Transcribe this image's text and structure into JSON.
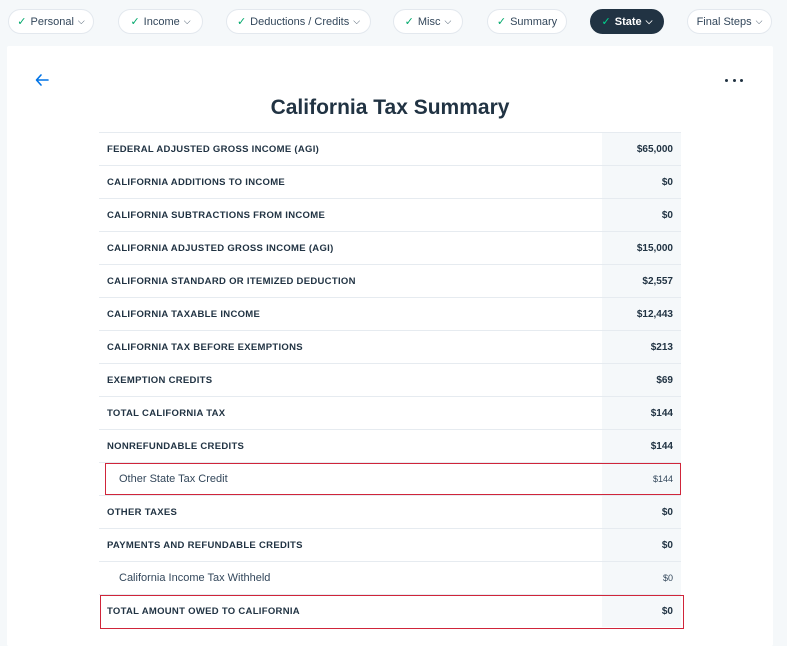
{
  "nav": {
    "tabs": [
      {
        "label": "Personal",
        "checked": true,
        "dropdown": true,
        "active": false
      },
      {
        "label": "Income",
        "checked": true,
        "dropdown": true,
        "active": false
      },
      {
        "label": "Deductions / Credits",
        "checked": true,
        "dropdown": true,
        "active": false
      },
      {
        "label": "Misc",
        "checked": true,
        "dropdown": true,
        "active": false
      },
      {
        "label": "Summary",
        "checked": true,
        "dropdown": false,
        "active": false
      },
      {
        "label": "State",
        "checked": true,
        "dropdown": true,
        "active": true
      },
      {
        "label": "Final Steps",
        "checked": false,
        "dropdown": true,
        "active": false
      }
    ]
  },
  "page": {
    "title": "California Tax Summary",
    "back_icon": "arrow-left-icon",
    "menu_icon": "more-horizontal-icon"
  },
  "summary": {
    "rows": [
      {
        "label": "FEDERAL ADJUSTED GROSS INCOME (AGI)",
        "value": "$65,000"
      },
      {
        "label": "CALIFORNIA ADDITIONS TO INCOME",
        "value": "$0"
      },
      {
        "label": "CALIFORNIA SUBTRACTIONS FROM INCOME",
        "value": "$0"
      },
      {
        "label": "CALIFORNIA ADJUSTED GROSS INCOME (AGI)",
        "value": "$15,000"
      },
      {
        "label": "CALIFORNIA STANDARD OR ITEMIZED DEDUCTION",
        "value": "$2,557"
      },
      {
        "label": "CALIFORNIA TAXABLE INCOME",
        "value": "$12,443"
      },
      {
        "label": "CALIFORNIA TAX BEFORE EXEMPTIONS",
        "value": "$213"
      },
      {
        "label": "EXEMPTION CREDITS",
        "value": "$69"
      },
      {
        "label": "TOTAL CALIFORNIA TAX",
        "value": "$144"
      },
      {
        "label": "NONREFUNDABLE CREDITS",
        "value": "$144"
      },
      {
        "label": "Other State Tax Credit",
        "value": "$144"
      },
      {
        "label": "OTHER TAXES",
        "value": "$0"
      },
      {
        "label": "PAYMENTS AND REFUNDABLE CREDITS",
        "value": "$0"
      },
      {
        "label": "California Income Tax Withheld",
        "value": "$0"
      },
      {
        "label": "TOTAL AMOUNT OWED TO CALIFORNIA",
        "value": "$0"
      }
    ]
  },
  "colors": {
    "active_tab_bg": "#213343",
    "check": "#00a86b",
    "highlight_border": "#d0253a",
    "link": "#0073e6"
  }
}
